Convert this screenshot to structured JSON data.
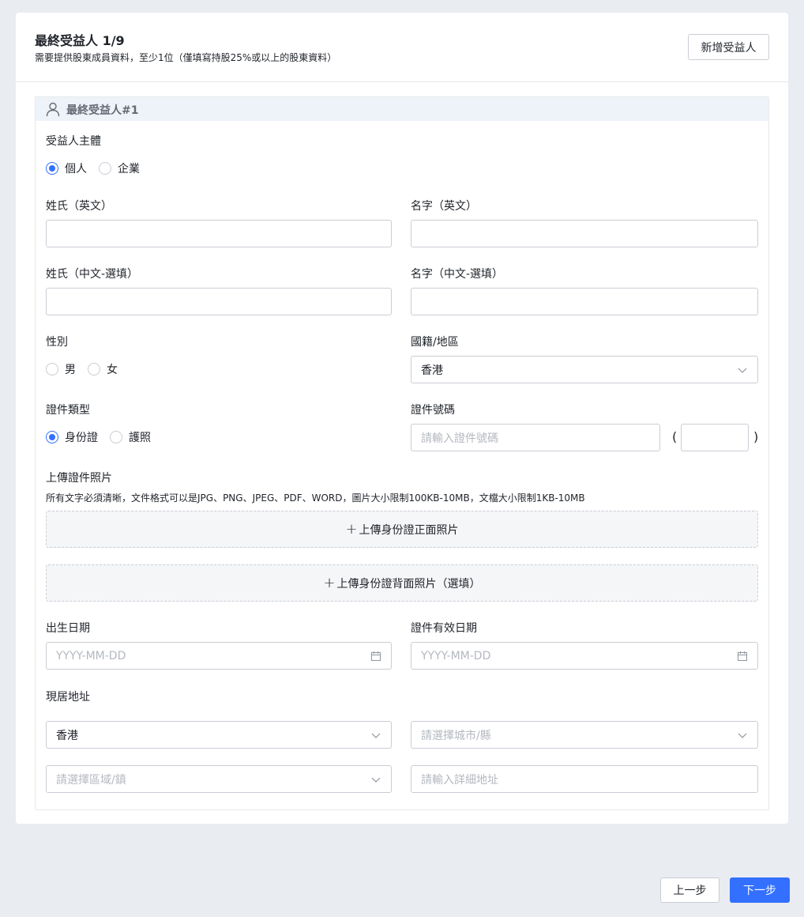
{
  "header": {
    "title": "最終受益人 1/9",
    "subtitle": "需要提供股東成員資料，至少1位（僅填寫持股25%或以上的股東資料）",
    "add_button": "新增受益人"
  },
  "section": {
    "title": "最終受益人#1",
    "icon": "user-icon"
  },
  "entity_type": {
    "label": "受益人主體",
    "options": [
      {
        "label": "個人",
        "selected": true
      },
      {
        "label": "企業",
        "selected": false
      }
    ]
  },
  "surname_en": {
    "label": "姓氏（英文）",
    "value": ""
  },
  "given_en": {
    "label": "名字（英文）",
    "value": ""
  },
  "surname_zh": {
    "label": "姓氏（中文-選填）",
    "value": ""
  },
  "given_zh": {
    "label": "名字（中文-選填）",
    "value": ""
  },
  "gender": {
    "label": "性別",
    "options": [
      {
        "label": "男",
        "selected": false
      },
      {
        "label": "女",
        "selected": false
      }
    ]
  },
  "nationality": {
    "label": "國籍/地區",
    "value": "香港"
  },
  "id_type": {
    "label": "證件類型",
    "options": [
      {
        "label": "身份證",
        "selected": true
      },
      {
        "label": "護照",
        "selected": false
      }
    ]
  },
  "id_number": {
    "label": "證件號碼",
    "placeholder": "請輸入證件號碼",
    "paren_open": "(",
    "paren_close": ")"
  },
  "upload": {
    "label": "上傳證件照片",
    "hint": "所有文字必須清晰，文件格式可以是JPG、PNG、JPEG、PDF、WORD，圖片大小限制100KB-10MB，文檔大小限制1KB-10MB",
    "plus": "+",
    "front": "上傳身份證正面照片",
    "back": "上傳身份證背面照片（選填）"
  },
  "birth_date": {
    "label": "出生日期",
    "placeholder": "YYYY-MM-DD"
  },
  "expiry_date": {
    "label": "證件有效日期",
    "placeholder": "YYYY-MM-DD"
  },
  "address": {
    "label": "現居地址",
    "country": "香港",
    "city_placeholder": "請選擇城市/縣",
    "district_placeholder": "請選擇區域/鎮",
    "detail_placeholder": "請輸入詳細地址"
  },
  "footer": {
    "prev": "上一步",
    "next": "下一步"
  },
  "colors": {
    "primary": "#3370ff",
    "background": "#e9ecf1",
    "section_header": "#eef3fa"
  }
}
